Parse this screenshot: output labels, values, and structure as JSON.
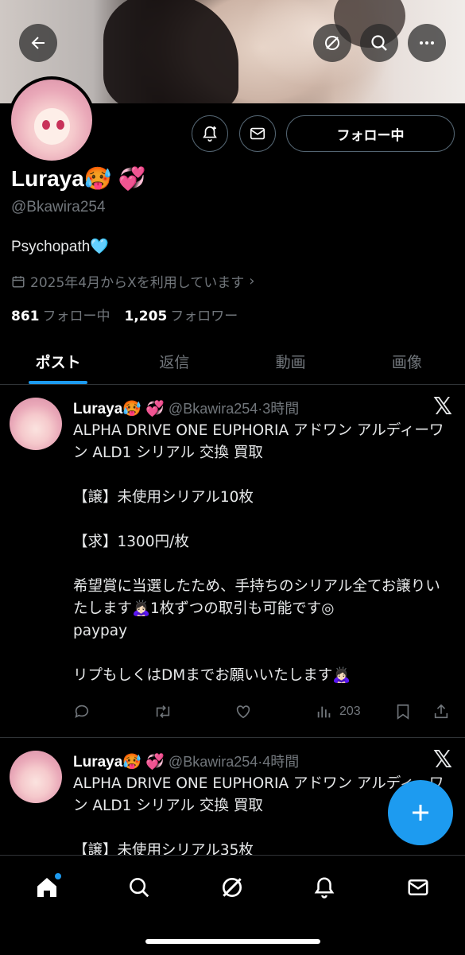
{
  "header": {
    "back_icon": "arrow-left-icon",
    "grok_icon": "grok-icon",
    "search_icon": "search-icon",
    "more_icon": "more-icon"
  },
  "profile": {
    "display_name": "Luraya🥵 💞",
    "handle": "@Bkawira254",
    "bio": "Psychopath🩵",
    "joined": "2025年4月からXを利用しています",
    "following_count": "861",
    "following_label": "フォロー中",
    "followers_count": "1,205",
    "followers_label": "フォロワー",
    "follow_button": "フォロー中"
  },
  "tabs": [
    {
      "label": "ポスト",
      "active": true
    },
    {
      "label": "返信",
      "active": false
    },
    {
      "label": "動画",
      "active": false
    },
    {
      "label": "画像",
      "active": false
    }
  ],
  "posts": [
    {
      "name": "Luraya🥵 💞",
      "handle": "@Bkawira254",
      "time": "·3時間",
      "body": "ALPHA DRIVE ONE EUPHORIA アドワン アルディーワン ALD1 シリアル 交換 買取\n\n【譲】未使用シリアル10枚\n\n【求】1300円/枚\n\n希望賞に当選したため、手持ちのシリアル全てお譲りいたします🙇🏻‍♀️1枚ずつの取引も可能です◎\npaypay\n\nリプもしくはDMまでお願いいたします🙇🏻‍♀️",
      "views": "203"
    },
    {
      "name": "Luraya🥵 💞",
      "handle": "@Bkawira254",
      "time": "·4時間",
      "body": "ALPHA DRIVE ONE EUPHORIA アドワン アルディーワン ALD1 シリアル 交換 買取\n\n【譲】未使用シリアル35枚"
    }
  ],
  "colors": {
    "accent": "#1d9bf0",
    "background": "#000000",
    "secondary_text": "#71767b"
  }
}
